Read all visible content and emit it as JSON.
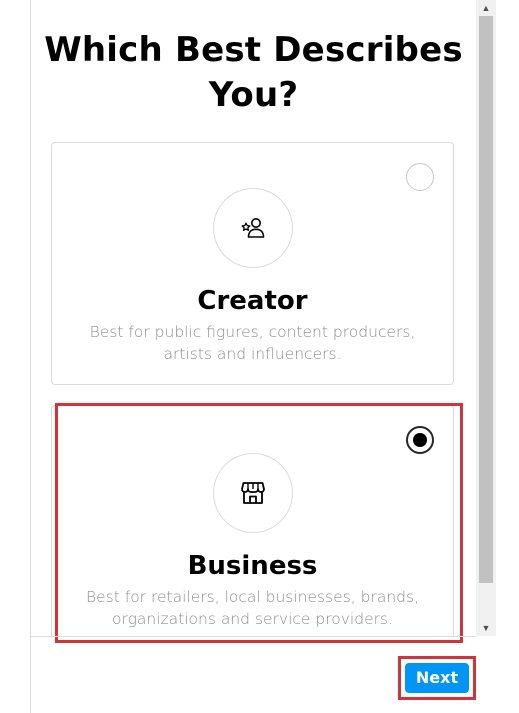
{
  "dialog": {
    "title": "Which Best Describes You?"
  },
  "options": [
    {
      "title": "Creator",
      "description": "Best for public figures, content producers, artists and influencers.",
      "icon": "creator-star-person-icon",
      "selected": false
    },
    {
      "title": "Business",
      "description": "Best for retailers, local businesses, brands, organizations and service providers.",
      "icon": "storefront-icon",
      "selected": true
    }
  ],
  "footer": {
    "next_label": "Next"
  },
  "colors": {
    "primary": "#0095f6",
    "highlight": "#d1343a",
    "muted_text": "#8e8e8e",
    "border": "#dbdbdb"
  }
}
